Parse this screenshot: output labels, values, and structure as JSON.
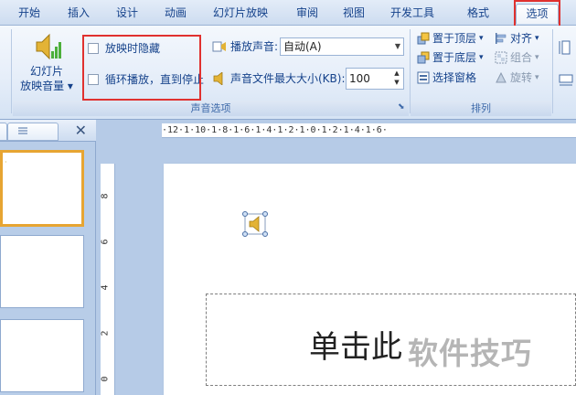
{
  "tabs": [
    {
      "label": "开始"
    },
    {
      "label": "插入"
    },
    {
      "label": "设计"
    },
    {
      "label": "动画"
    },
    {
      "label": "幻灯片放映"
    },
    {
      "label": "审阅"
    },
    {
      "label": "视图"
    },
    {
      "label": "开发工具"
    },
    {
      "label": "格式"
    },
    {
      "label": "选项"
    }
  ],
  "sound_group": {
    "volume_line1": "幻灯片",
    "volume_line2": "放映音量",
    "hide_during_show": "放映时隐藏",
    "loop_until_stopped": "循环播放，直到停止",
    "play_sound_label": "播放声音:",
    "play_sound_value": "自动(A)",
    "max_size_label": "声音文件最大大小(KB):",
    "max_size_value": "100",
    "group_label": "声音选项"
  },
  "arrange_group": {
    "bring_to_front": "置于顶层",
    "send_to_back": "置于底层",
    "selection_pane": "选择窗格",
    "align": "对齐",
    "group": "组合",
    "rotate": "旋转",
    "group_label": "排列"
  },
  "ruler": {
    "horizontal": "·12·1·10·1·8·1·6·1·4·1·2·1·0·1·2·1·4·1·6·",
    "vertical_marks": [
      "8",
      "6",
      "4",
      "2",
      "0"
    ]
  },
  "slide": {
    "title_placeholder": "单击此"
  },
  "watermark": "软件技巧",
  "colors": {
    "highlight_red": "#e0312f",
    "ribbon_text": "#15428b",
    "selected_thumb_border": "#e7a532"
  }
}
